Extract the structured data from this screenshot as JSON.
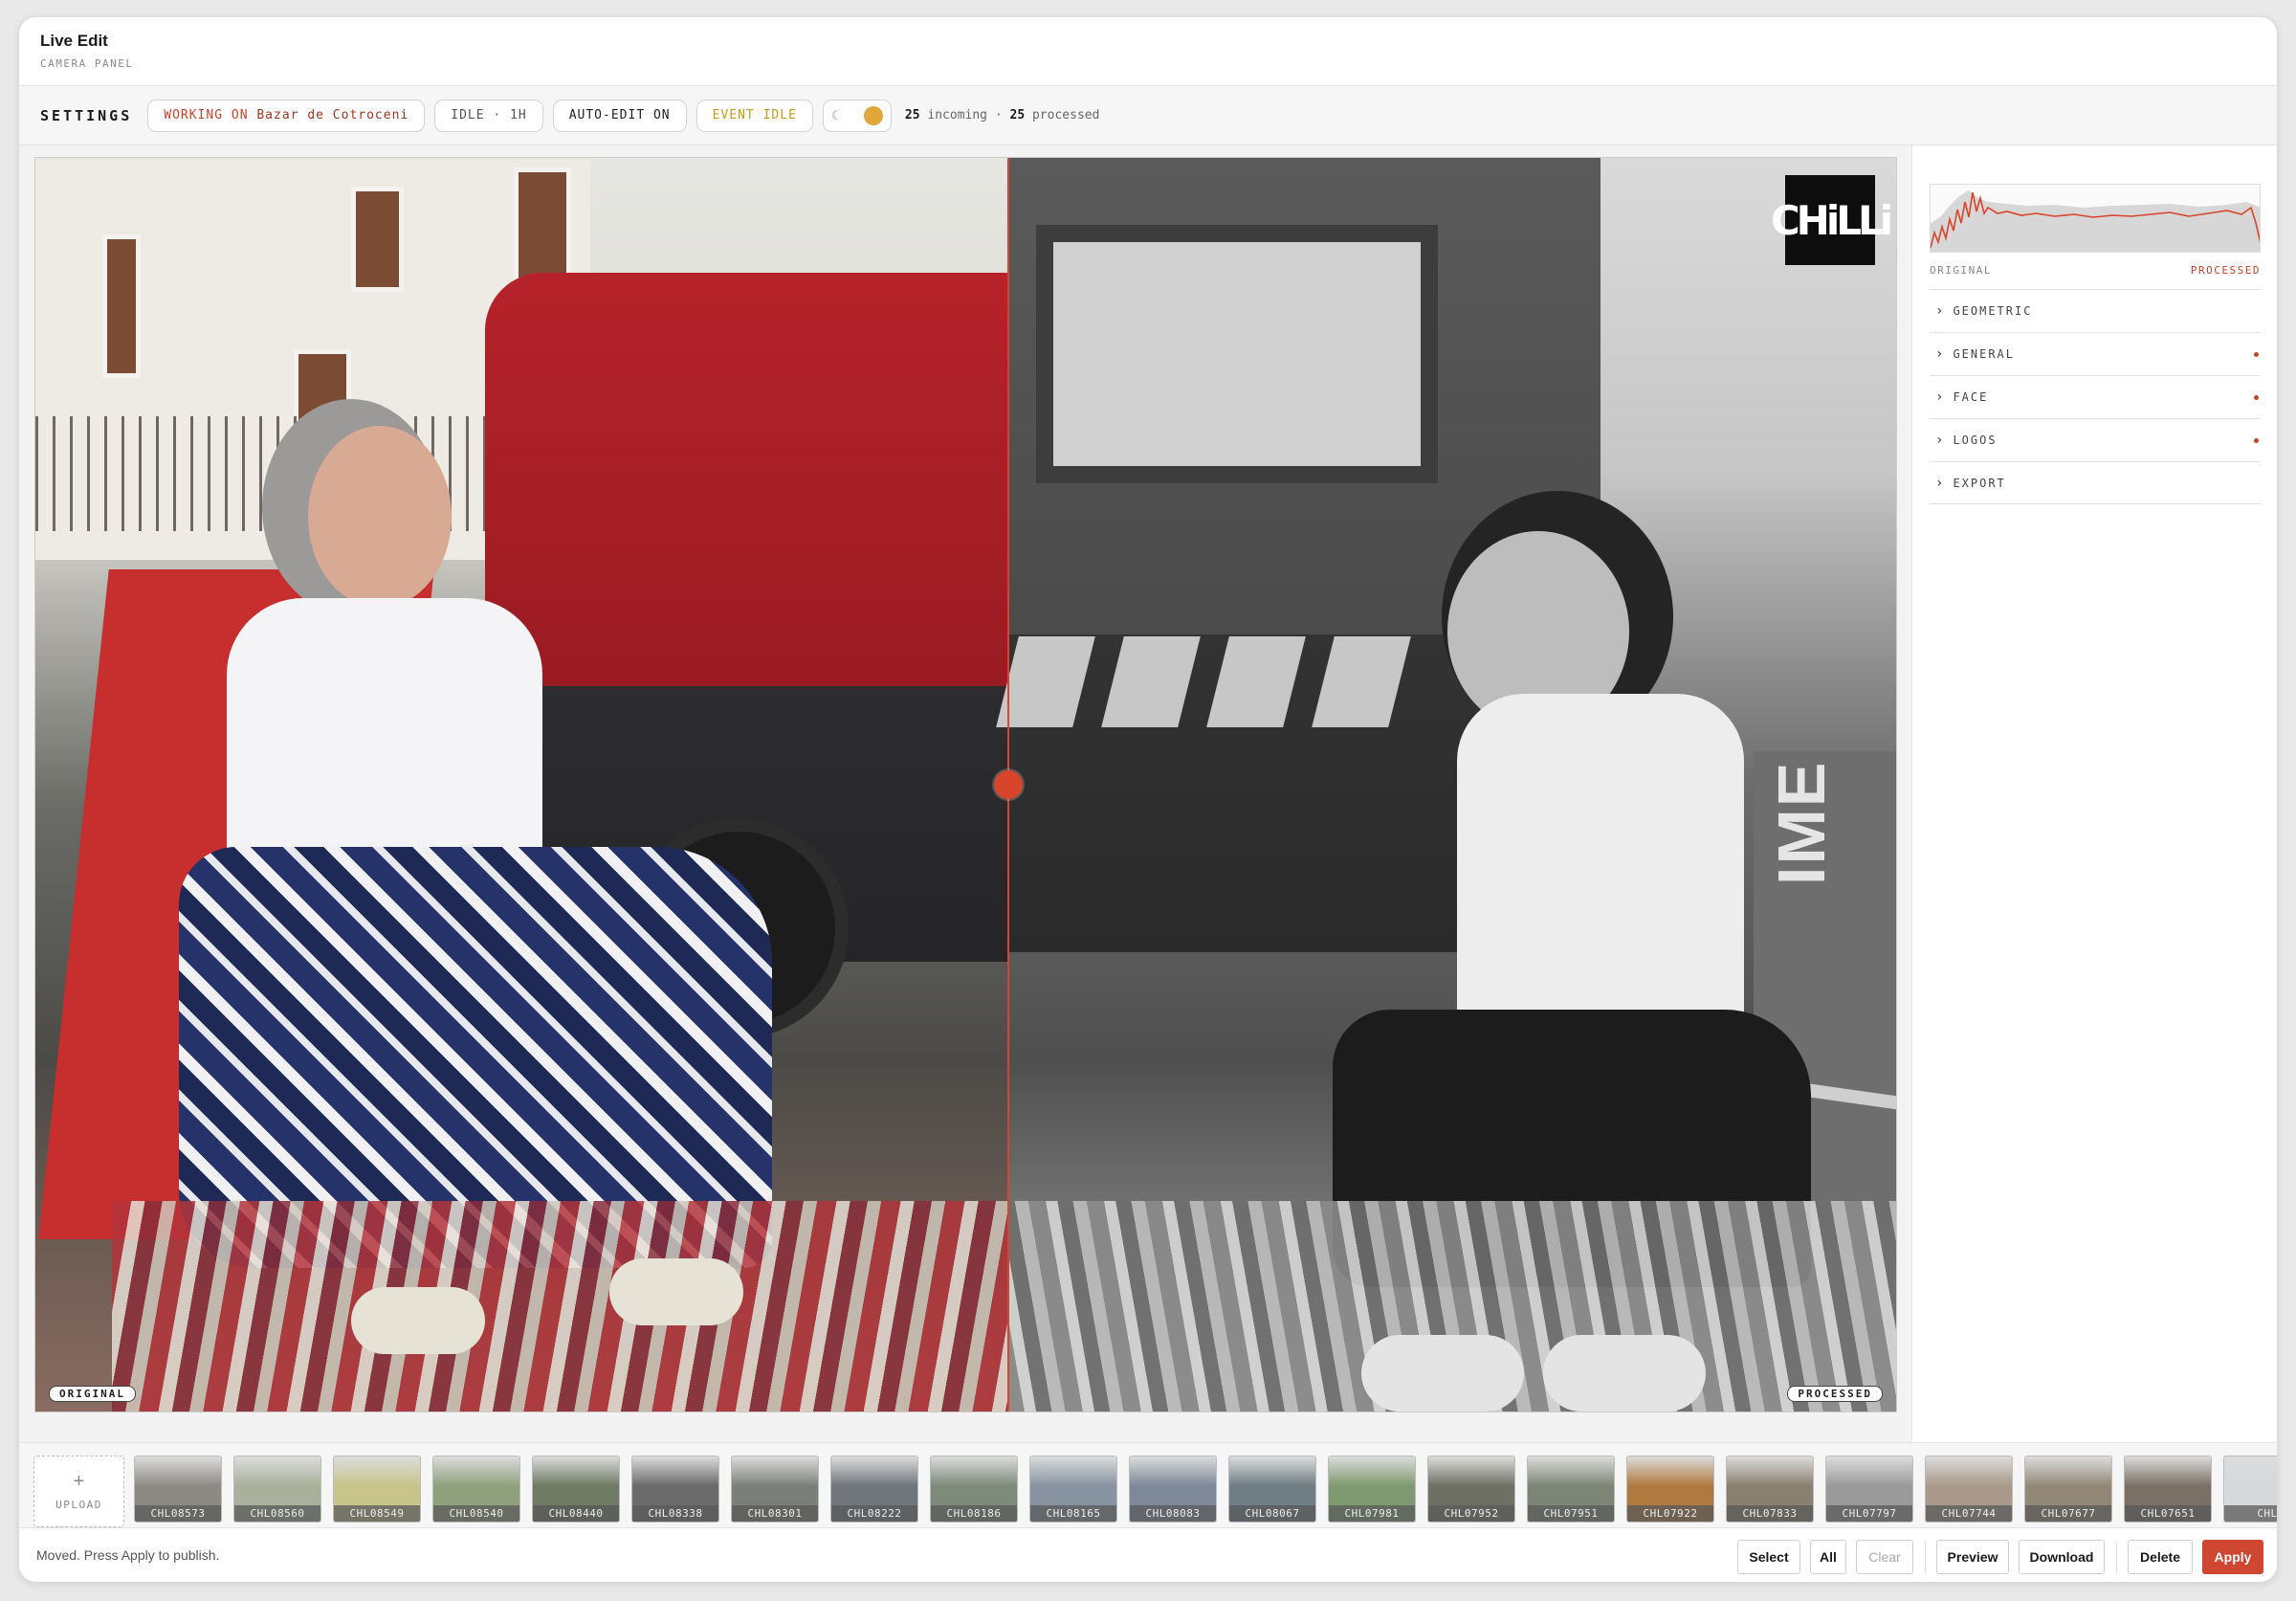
{
  "window": {
    "title": "Live Edit",
    "subtitle": "CAMERA PANEL"
  },
  "toolbar": {
    "settings_label": "SETTINGS",
    "working_prefix": "WORKING ON",
    "working_event": "Bazar de Cotroceni",
    "idle_label": "IDLE · 1H",
    "auto_edit_label": "AUTO-EDIT ON",
    "event_label": "EVENT IDLE",
    "theme_toggle_icon": "moon-icon",
    "incoming_count": "25",
    "incoming_label": "incoming ·",
    "processed_count": "25",
    "processed_label": "processed"
  },
  "viewer": {
    "left_tag": "ORIGINAL",
    "right_tag": "PROCESSED",
    "logo_text": "CHiLLi",
    "banner_text": "IME",
    "split_position_percent": 52.2
  },
  "panel": {
    "histogram_left_label": "ORIGINAL",
    "histogram_right_label": "PROCESSED",
    "sections": [
      {
        "label": "GEOMETRIC",
        "modified": false
      },
      {
        "label": "GENERAL",
        "modified": true
      },
      {
        "label": "FACE",
        "modified": true
      },
      {
        "label": "LOGOS",
        "modified": true
      },
      {
        "label": "EXPORT",
        "modified": false
      }
    ]
  },
  "strip": {
    "upload_label": "UPLOAD",
    "thumbnails": [
      {
        "name": "CHL08573",
        "color": "#8d8a84"
      },
      {
        "name": "CHL08560",
        "color": "#a9b19c"
      },
      {
        "name": "CHL08549",
        "color": "#c8c48c"
      },
      {
        "name": "CHL08540",
        "color": "#8fa17c"
      },
      {
        "name": "CHL08440",
        "color": "#6e7a62"
      },
      {
        "name": "CHL08338",
        "color": "#6b6b6b"
      },
      {
        "name": "CHL08301",
        "color": "#7c7f79"
      },
      {
        "name": "CHL08222",
        "color": "#70767c"
      },
      {
        "name": "CHL08186",
        "color": "#7e8a7a"
      },
      {
        "name": "CHL08165",
        "color": "#8793a0"
      },
      {
        "name": "CHL08083",
        "color": "#7d8898"
      },
      {
        "name": "CHL08067",
        "color": "#6f7d84"
      },
      {
        "name": "CHL07981",
        "color": "#7f9a70"
      },
      {
        "name": "CHL07952",
        "color": "#6f7064"
      },
      {
        "name": "CHL07951",
        "color": "#7d8676"
      },
      {
        "name": "CHL07922",
        "color": "#b07a3f"
      },
      {
        "name": "CHL07833",
        "color": "#8a8070"
      },
      {
        "name": "CHL07797",
        "color": "#9a9a9a"
      },
      {
        "name": "CHL07744",
        "color": "#a9998a"
      },
      {
        "name": "CHL07677",
        "color": "#938878"
      },
      {
        "name": "CHL07651",
        "color": "#7a7066"
      },
      {
        "name": "CHL",
        "color": "#d6d8da"
      }
    ]
  },
  "footer": {
    "status": "Moved. Press Apply to publish.",
    "select_label": "Select",
    "all_label": "All",
    "clear_label": "Clear",
    "preview_label": "Preview",
    "download_label": "Download",
    "delete_label": "Delete",
    "apply_label": "Apply"
  },
  "colors": {
    "accent": "#cf4631",
    "amber": "#e2a73a"
  }
}
